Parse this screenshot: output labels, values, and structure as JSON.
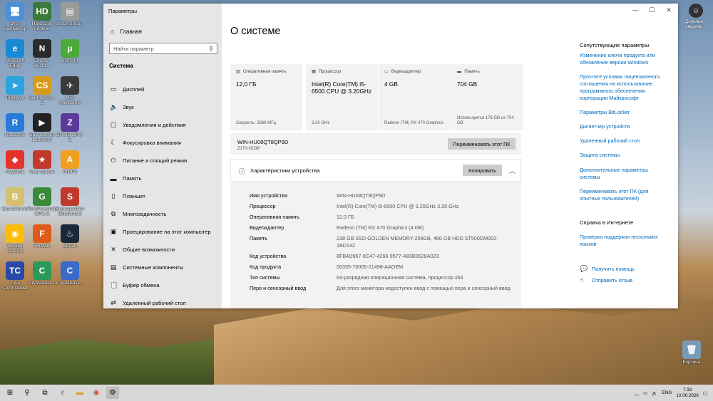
{
  "desktop": {
    "icons": [
      {
        "label": "Этот компьютер",
        "color": "#4a90d9",
        "glyph": "🖥"
      },
      {
        "label": "Hard Disk Sentinel",
        "color": "#3a7a3a",
        "glyph": "HD"
      },
      {
        "label": "photo_2026...",
        "color": "#9a9a9a",
        "glyph": "▤"
      },
      {
        "label": "Microsoft Edge",
        "color": "#1a8ad4",
        "glyph": "e"
      },
      {
        "label": "596.49-deskt...",
        "color": "#2a2a2a",
        "glyph": "N"
      },
      {
        "label": "utorrent",
        "color": "#4caa3a",
        "glyph": "µ"
      },
      {
        "label": "Telegram",
        "color": "#2aa3df",
        "glyph": "➤"
      },
      {
        "label": "Counter-Str... 2",
        "color": "#d89a1a",
        "glyph": "CS"
      },
      {
        "label": "MSI Afterburner",
        "color": "#3a3a3a",
        "glyph": "✈"
      },
      {
        "label": "RustDesk",
        "color": "#2a7ad9",
        "glyph": "R"
      },
      {
        "label": "Epic Games Launcher",
        "color": "#222",
        "glyph": "▶"
      },
      {
        "label": "CPUID CPU-Z",
        "color": "#5a3a9a",
        "glyph": "Z"
      },
      {
        "label": "AnyDesk",
        "color": "#e5322d",
        "glyph": "◆"
      },
      {
        "label": "Мир танков",
        "color": "#c0392b",
        "glyph": "★"
      },
      {
        "label": "AIMP3",
        "color": "#f0a020",
        "glyph": "A"
      },
      {
        "label": "BoardViewer",
        "color": "#d4c070",
        "glyph": "B"
      },
      {
        "label": "TechPowerUp GPU-Z",
        "color": "#3a8a3a",
        "glyph": "G"
      },
      {
        "label": "Superposition Benchmark",
        "color": "#c0392b",
        "glyph": "S"
      },
      {
        "label": "Google Chrome",
        "color": "#fbbc05",
        "glyph": "◉"
      },
      {
        "label": "FurMark",
        "color": "#e05a1a",
        "glyph": "F"
      },
      {
        "label": "Steam",
        "color": "#1b2838",
        "glyph": "♨"
      },
      {
        "label": "Total Commander",
        "color": "#2a4aaa",
        "glyph": "TC"
      },
      {
        "label": "CrystalDisk...",
        "color": "#2a9a5a",
        "glyph": "C"
      },
      {
        "label": "CrystalDisk...",
        "color": "#3a6aca",
        "glyph": "C"
      }
    ],
    "user_label": "Дополни... сведени...",
    "recycle_label": "Корзина"
  },
  "window": {
    "title": "Параметры",
    "home": "Главная",
    "search_placeholder": "Найти параметр",
    "section": "Система",
    "nav": [
      {
        "label": "Дисплей",
        "icon": "display-icon",
        "glyph": "▭"
      },
      {
        "label": "Звук",
        "icon": "sound-icon",
        "glyph": "🔈"
      },
      {
        "label": "Уведомления и действия",
        "icon": "notifications-icon",
        "glyph": "▢"
      },
      {
        "label": "Фокусировка внимания",
        "icon": "focus-icon",
        "glyph": "☾"
      },
      {
        "label": "Питание и спящий режим",
        "icon": "power-icon",
        "glyph": "⏻"
      },
      {
        "label": "Память",
        "icon": "storage-icon",
        "glyph": "▬"
      },
      {
        "label": "Планшет",
        "icon": "tablet-icon",
        "glyph": "▯"
      },
      {
        "label": "Многозадачность",
        "icon": "multitasking-icon",
        "glyph": "⧉"
      },
      {
        "label": "Проецирование на этот компьютер",
        "icon": "projecting-icon",
        "glyph": "▣"
      },
      {
        "label": "Общие возможности",
        "icon": "shared-experiences-icon",
        "glyph": "✕"
      },
      {
        "label": "Системные компоненты",
        "icon": "system-components-icon",
        "glyph": "▤"
      },
      {
        "label": "Буфер обмена",
        "icon": "clipboard-icon",
        "glyph": "📋"
      },
      {
        "label": "Удаленный рабочий стол",
        "icon": "remote-desktop-icon",
        "glyph": "⇄"
      }
    ],
    "page_title": "О системе",
    "cards": [
      {
        "title": "Оперативная память",
        "value": "12,0 ГБ",
        "sub": "Скорость: 2666 МГц",
        "icon": "ram-icon",
        "glyph": "▥"
      },
      {
        "title": "Процессор",
        "value": "Intel(R) Core(TM) i5-6500 CPU @ 3.20GHz",
        "sub": "3.20 GHz",
        "icon": "cpu-icon",
        "glyph": "▦"
      },
      {
        "title": "Видеоадаптер",
        "value": "4 GB",
        "sub": "Radeon (TM) RX 470 Graphics",
        "icon": "gpu-icon",
        "glyph": "▭"
      },
      {
        "title": "Память",
        "value": "704 GB",
        "sub": "Используется 176 GB из 704 GB",
        "icon": "disk-icon",
        "glyph": "▬"
      }
    ],
    "pc_name": "WIN-HU08QT8QP9D",
    "pc_board": "Z170-HD3P",
    "rename_label": "Переименовать этот ПК",
    "specs_title": "Характеристики устройства",
    "copy_label": "Копировать",
    "specs": [
      {
        "label": "Имя устройства",
        "value": "WIN-HU08QT8QP9D"
      },
      {
        "label": "Процессор",
        "value": "Intel(R) Core(TM) i5-6500 CPU @ 3.20GHz   3.20 GHz"
      },
      {
        "label": "Оперативная память",
        "value": "12,0 ГБ"
      },
      {
        "label": "Видеоадаптер",
        "value": "Radeon (TM) RX 470 Graphics (4 GB)"
      },
      {
        "label": "Память",
        "value": "238 GB SSD GOLDEN MEMORY-256GB, 466 GB HDD ST500DM002-1BD142"
      },
      {
        "label": "Код устройства",
        "value": "8FB4D967-9C47-4266-9577-A83B0628A023"
      },
      {
        "label": "Код продукта",
        "value": "00355-70005-21498-AAOEM"
      },
      {
        "label": "Тип системы",
        "value": "64-разрядная операционная система, процессор x64"
      },
      {
        "label": "Перо и сенсорный ввод",
        "value": "Для этого монитора недоступен ввод с помощью пера и сенсорный ввод"
      }
    ],
    "related_title": "Сопутствующие параметры",
    "related_links": [
      "Изменение ключа продукта или обновление версии Windows",
      "Прочтите условия лицензионного соглашения на использование программного обеспечения корпорации Майкрософт",
      "Параметры BitLocker",
      "Диспетчер устройств",
      "Удаленный рабочий стол",
      "Защита системы",
      "Дополнительные параметры системы",
      "Переименовать этот ПК (для опытных пользователей)"
    ],
    "help_title": "Справка в Интернете",
    "help_link": "Проверка поддержки нескольких языков",
    "get_help": "Получить помощь",
    "feedback": "Отправить отзыв"
  },
  "taskbar": {
    "lang": "ENG",
    "time": "7:33",
    "date": "10.06.2026"
  }
}
